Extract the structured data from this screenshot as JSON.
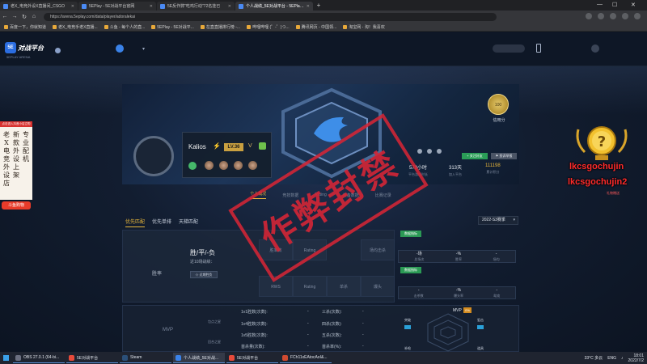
{
  "browser": {
    "tabs": [
      {
        "label": "老X_电竞外设X直播间_CSGO",
        "active": false
      },
      {
        "label": "5EPlay - 5E对战平台官网",
        "active": false
      },
      {
        "label": "5E反作弊\"吃鸡行动\"72名挂已",
        "active": false
      },
      {
        "label": "个人战绩_5E对战平台 - 5EPlay对战",
        "active": true
      }
    ],
    "url": "https://arena.5eplay.com/data/player/adoralekai",
    "bookmarks": [
      "百度一下，你就知道",
      "老X_电竞手老X直播...",
      "斗鱼 - 每个人的直...",
      "5EPlay - 5E对战平...",
      "在直直播排行榜 -...",
      "哔哩哔哩 (゜-゜)つ...",
      "腾讯网页 - 中国领...",
      "淘宝网 - 淘！我喜欢"
    ]
  },
  "site": {
    "logo_badge": "5E",
    "logo_name": "对战平台",
    "logo_sub": "5EPLAY ARENA"
  },
  "profile": {
    "player_name": "Kalios",
    "level": "LV.36",
    "credit_value": "100",
    "credit_label": "信用分",
    "bind_button": "+ 关注好友",
    "report_button": "⚑ 投诉举报",
    "stats": [
      {
        "value": "579小时",
        "label": "平台游戏时长"
      },
      {
        "value": "313天",
        "label": "加入平台"
      },
      {
        "value": "111198",
        "label": "累计积分"
      }
    ],
    "subtabs": [
      "个人概况",
      "竞技数据",
      "Rating",
      "装备数据",
      "比赛记录"
    ],
    "active_subtab": 0
  },
  "modes": {
    "tabs": [
      "优先匹配",
      "优先单排",
      "天梯匹配"
    ],
    "active": 0,
    "season": "2022-S3赛季"
  },
  "panel": {
    "winrate_label": "胜率",
    "wl_title": "胜/平/-负",
    "wl_sub": "近10场战绩：",
    "wl_button": "☆ 近期胜负",
    "grid": [
      "胜率数",
      "Rating",
      "场均击杀",
      "RWS",
      "Rating",
      "单杀",
      "爆头"
    ],
    "right_tag_1": "数据指标",
    "right_row_1": [
      {
        "value": "-场",
        "label": "总场次"
      },
      {
        "value": "-%",
        "label": "胜率"
      },
      {
        "value": "-",
        "label": "场均"
      }
    ],
    "right_tag_2": "数据指标",
    "right_row_2": [
      {
        "value": "-",
        "label": "击杀数"
      },
      {
        "value": "-%",
        "label": "爆头率"
      },
      {
        "value": "-",
        "label": "助攻"
      }
    ]
  },
  "bottom": {
    "mvp_label": "MVP",
    "side_labels": [
      "包点之星",
      "回合之星"
    ],
    "rows": [
      {
        "label": "1v1胜数(次数):",
        "val": "-",
        "label2": "三杀(次数):",
        "val2": "-"
      },
      {
        "label": "1v4胜数(次数):",
        "val": "-",
        "label2": "四杀(次数):",
        "val2": "-"
      },
      {
        "label": "1v5胜数(次数):",
        "val": "-",
        "label2": "五杀(次数):",
        "val2": "-"
      },
      {
        "label": "首杀量(次数):",
        "val": "-",
        "label2": "首杀率(%):",
        "val2": "-"
      }
    ],
    "mvp_tag": "MVP",
    "mvp_count": "0%",
    "radar_labels": [
      "突破",
      "狙击",
      "补枪",
      "道具"
    ]
  },
  "stamp": {
    "text": "作弊封禁"
  },
  "overlay_left": {
    "top_text": "点击进入抖音小店立购",
    "col1": "老X电竞外设店",
    "col2": "新款外设上架",
    "col3": "专业配机",
    "bottom": "斗鱼购物"
  },
  "overlay_right": {
    "name1": "lkcsgochujin",
    "name2": "lkcsgochujin2",
    "sub": "礼物赠送"
  },
  "taskbar": {
    "items": [
      {
        "label": "OBS 27.0.1 (64-bi...",
        "color": "#6b6f80"
      },
      {
        "label": "5E对战平台",
        "color": "#e84a3a"
      },
      {
        "label": "Steam",
        "color": "#2b4f78"
      },
      {
        "label": "个人战绩_5E对战...",
        "color": "#3a82e8"
      },
      {
        "label": "5E对战平台",
        "color": "#e84a3a"
      },
      {
        "label": "FCh11xEAtocAoI&...",
        "color": "#d04a30"
      }
    ],
    "weather": "33°C 多云",
    "lang": "ENG",
    "time": "18:01",
    "date": "2022/7/2"
  }
}
